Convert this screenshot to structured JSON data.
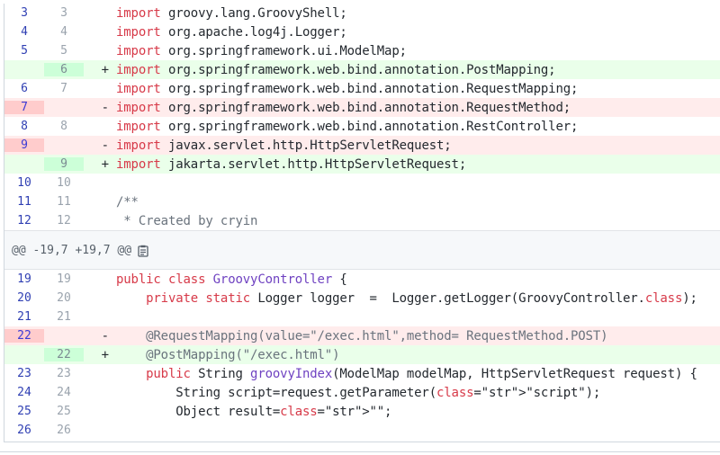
{
  "hunk1": [
    {
      "type": "ctx",
      "old": "3",
      "new": "3",
      "marker": "",
      "code": "import groovy.lang.GroovyShell;"
    },
    {
      "type": "ctx",
      "old": "4",
      "new": "4",
      "marker": "",
      "code": "import org.apache.log4j.Logger;"
    },
    {
      "type": "ctx",
      "old": "5",
      "new": "5",
      "marker": "",
      "code": "import org.springframework.ui.ModelMap;"
    },
    {
      "type": "add",
      "old": "",
      "new": "6",
      "marker": "+",
      "code": "import org.springframework.web.bind.annotation.PostMapping;"
    },
    {
      "type": "ctx",
      "old": "6",
      "new": "7",
      "marker": "",
      "code": "import org.springframework.web.bind.annotation.RequestMapping;"
    },
    {
      "type": "del",
      "old": "7",
      "new": "",
      "marker": "-",
      "code": "import org.springframework.web.bind.annotation.RequestMethod;"
    },
    {
      "type": "ctx",
      "old": "8",
      "new": "8",
      "marker": "",
      "code": "import org.springframework.web.bind.annotation.RestController;"
    },
    {
      "type": "del",
      "old": "9",
      "new": "",
      "marker": "-",
      "code": "import javax.servlet.http.HttpServletRequest;"
    },
    {
      "type": "add",
      "old": "",
      "new": "9",
      "marker": "+",
      "code": "import jakarta.servlet.http.HttpServletRequest;"
    },
    {
      "type": "ctx",
      "old": "10",
      "new": "10",
      "marker": "",
      "code": ""
    },
    {
      "type": "ctx",
      "old": "11",
      "new": "11",
      "marker": "",
      "code": "/**"
    },
    {
      "type": "ctx",
      "old": "12",
      "new": "12",
      "marker": "",
      "code": " * Created by cryin"
    }
  ],
  "hunk_header": "@@ -19,7 +19,7 @@",
  "hunk2": [
    {
      "type": "ctx",
      "old": "19",
      "new": "19",
      "marker": "",
      "code": "public class GroovyController {"
    },
    {
      "type": "ctx",
      "old": "20",
      "new": "20",
      "marker": "",
      "code": "    private static Logger logger  =  Logger.getLogger(GroovyController.class);"
    },
    {
      "type": "ctx",
      "old": "21",
      "new": "21",
      "marker": "",
      "code": ""
    },
    {
      "type": "del",
      "old": "22",
      "new": "",
      "marker": "-",
      "code": "    @RequestMapping(value=\"/exec.html\",method= RequestMethod.POST)"
    },
    {
      "type": "add",
      "old": "",
      "new": "22",
      "marker": "+",
      "code": "    @PostMapping(\"/exec.html\")"
    },
    {
      "type": "ctx",
      "old": "23",
      "new": "23",
      "marker": "",
      "code": "    public String groovyIndex(ModelMap modelMap, HttpServletRequest request) {"
    },
    {
      "type": "ctx",
      "old": "24",
      "new": "24",
      "marker": "",
      "code": "        String script=request.getParameter(\"script\");"
    },
    {
      "type": "ctx",
      "old": "25",
      "new": "25",
      "marker": "",
      "code": "        Object result=\"\";"
    },
    {
      "type": "ctx",
      "old": "26",
      "new": "26",
      "marker": "",
      "code": ""
    }
  ],
  "icons": {
    "hunk_copy": "clipboard-icon"
  },
  "colors": {
    "add_bg": "#eaffea",
    "del_bg": "#ffecec",
    "add_gutter": "#ccffd8",
    "del_gutter": "#ffcccc",
    "keyword": "#d73a49",
    "type_name": "#6f42c1",
    "string": "#032f62",
    "comment": "#6a737d"
  }
}
